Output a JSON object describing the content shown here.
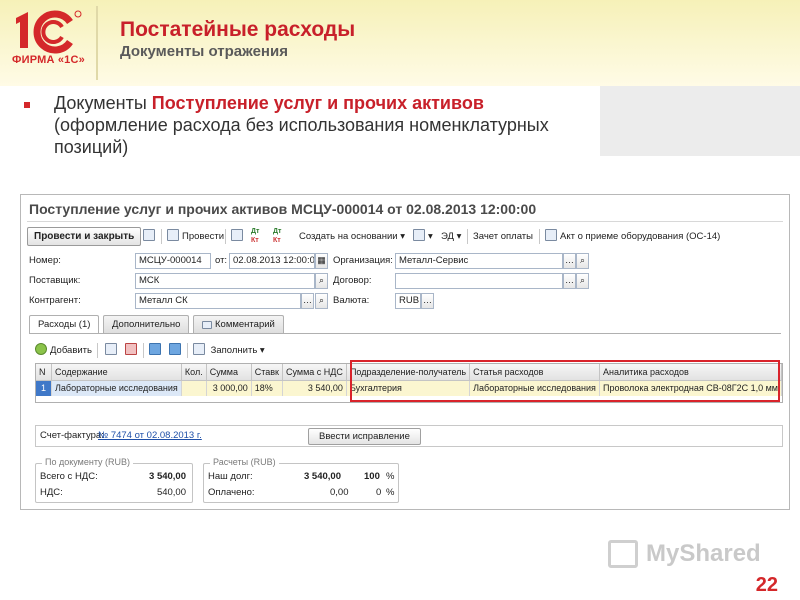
{
  "slide": {
    "logo_mark": "1С",
    "logo_firm": "ФИРМА «1С»",
    "title": "Постатейные расходы",
    "subtitle": "Документы отражения",
    "bullet_prefix": "Документы ",
    "bullet_highlight": "Поступление услуг и прочих активов",
    "bullet_rest": "(оформление расхода без использования номенклатурных позиций)",
    "page_number": "22",
    "watermark": "MyShared"
  },
  "form": {
    "title": "Поступление услуг и прочих активов МСЦУ-000014 от 02.08.2013 12:00:00",
    "toolbar": {
      "post_close": "Провести и закрыть",
      "post": "Провести",
      "dt_kt_a": "Дт",
      "dt_kt_b": "Кт",
      "create_based": "Создать на основании",
      "ed": "ЭД",
      "payment_invoice": "Зачет оплаты",
      "act": "Акт о приеме оборудования (ОС-14)"
    },
    "fields": {
      "number_label": "Номер:",
      "number_value": "МСЦУ-000014",
      "date_label": "от:",
      "date_value": "02.08.2013 12:00:00",
      "org_label": "Организация:",
      "org_value": "Металл-Сервис",
      "supplier_label": "Поставщик:",
      "supplier_value": "МСК",
      "contract_label": "Договор:",
      "contract_value": "",
      "counterparty_label": "Контрагент:",
      "counterparty_value": "Металл СК",
      "currency_label": "Валюта:",
      "currency_value": "RUB"
    },
    "tabs": [
      "Расходы (1)",
      "Дополнительно",
      "Комментарий"
    ],
    "table_toolbar": {
      "add": "Добавить",
      "fill": "Заполнить"
    },
    "table": {
      "columns": [
        "N",
        "Содержание",
        "Кол.",
        "Сумма",
        "Ставк",
        "Сумма с НДС",
        "Подразделение-получатель",
        "Статья расходов",
        "Аналитика расходов"
      ],
      "rows": [
        [
          "1",
          "Лабораторные исследования",
          "",
          "3 000,00",
          "18%",
          "3 540,00",
          "Бухгалтерия",
          "Лабораторные исследования",
          "Проволока электродная СВ-08Г2С 1,0 мм"
        ]
      ]
    },
    "invoice": {
      "label": "Счет-фактура:",
      "link": "№ 7474 от 02.08.2013 г.",
      "fix_button": "Ввести исправление"
    },
    "by_document": {
      "caption": "По документу (RUB)",
      "total_label": "Всего с НДС:",
      "total_value": "3 540,00",
      "vat_label": "НДС:",
      "vat_value": "540,00"
    },
    "settlements": {
      "caption": "Расчеты (RUB)",
      "debt_label": "Наш долг:",
      "debt_value": "3 540,00",
      "debt_pct": "100",
      "paid_label": "Оплачено:",
      "paid_value": "0,00",
      "paid_pct": "0",
      "pct_sign": "%"
    }
  },
  "colors": {
    "brand_red": "#d4282a",
    "highlight_box": "#d9232b",
    "selected_row": "#fbf6d0"
  }
}
